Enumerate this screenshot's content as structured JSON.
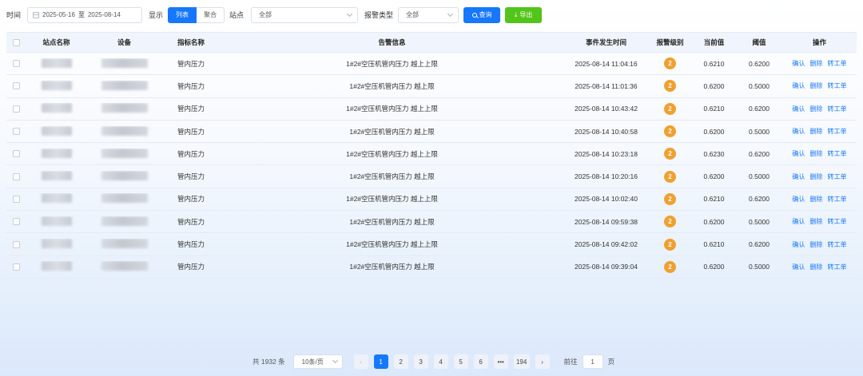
{
  "filters": {
    "time_label": "时间",
    "date_start": "2025-05-16",
    "date_sep": "至",
    "date_end": "2025-08-14",
    "display_label": "显示",
    "display_options": [
      "列表",
      "聚合"
    ],
    "station_label": "站点",
    "station_value": "全部",
    "alarm_type_label": "报警类型",
    "alarm_type_value": "全部",
    "query_label": "查询",
    "export_label": "导出",
    "accent_color": "#1677ff",
    "export_color": "#52c41a"
  },
  "table": {
    "headers": [
      "站点名称",
      "设备",
      "指标名称",
      "告警信息",
      "事件发生时间",
      "报警级别",
      "当前值",
      "阈值",
      "操作"
    ],
    "rows": [
      {
        "metric": "管内压力",
        "message": "1#2#空压机管内压力 越上上限",
        "time": "2025-08-14 11:04:16",
        "level": "2",
        "current": "0.6210",
        "threshold": "0.6200"
      },
      {
        "metric": "管内压力",
        "message": "1#2#空压机管内压力 越上限",
        "time": "2025-08-14 11:01:36",
        "level": "2",
        "current": "0.6200",
        "threshold": "0.5000"
      },
      {
        "metric": "管内压力",
        "message": "1#2#空压机管内压力 越上上限",
        "time": "2025-08-14 10:43:42",
        "level": "2",
        "current": "0.6210",
        "threshold": "0.6200"
      },
      {
        "metric": "管内压力",
        "message": "1#2#空压机管内压力 越上限",
        "time": "2025-08-14 10:40:58",
        "level": "2",
        "current": "0.6200",
        "threshold": "0.5000"
      },
      {
        "metric": "管内压力",
        "message": "1#2#空压机管内压力 越上上限",
        "time": "2025-08-14 10:23:18",
        "level": "2",
        "current": "0.6230",
        "threshold": "0.6200"
      },
      {
        "metric": "管内压力",
        "message": "1#2#空压机管内压力 越上限",
        "time": "2025-08-14 10:20:16",
        "level": "2",
        "current": "0.6200",
        "threshold": "0.5000"
      },
      {
        "metric": "管内压力",
        "message": "1#2#空压机管内压力 越上上限",
        "time": "2025-08-14 10:02:40",
        "level": "2",
        "current": "0.6210",
        "threshold": "0.6200"
      },
      {
        "metric": "管内压力",
        "message": "1#2#空压机管内压力 越上限",
        "time": "2025-08-14 09:59:38",
        "level": "2",
        "current": "0.6200",
        "threshold": "0.5000"
      },
      {
        "metric": "管内压力",
        "message": "1#2#空压机管内压力 越上上限",
        "time": "2025-08-14 09:42:02",
        "level": "2",
        "current": "0.6210",
        "threshold": "0.6200"
      },
      {
        "metric": "管内压力",
        "message": "1#2#空压机管内压力 越上限",
        "time": "2025-08-14 09:39:04",
        "level": "2",
        "current": "0.6200",
        "threshold": "0.5000"
      }
    ],
    "actions": [
      "确认",
      "删除",
      "转工单"
    ],
    "level_color": "#f0a030"
  },
  "pagination": {
    "total_text": "共 1932 条",
    "page_size": "10条/页",
    "prev_icon": "‹",
    "pages": [
      "1",
      "2",
      "3",
      "4",
      "5",
      "6",
      "•••",
      "194"
    ],
    "next_icon": "›",
    "goto_label": "前往",
    "goto_value": "1",
    "page_suffix": "页"
  }
}
